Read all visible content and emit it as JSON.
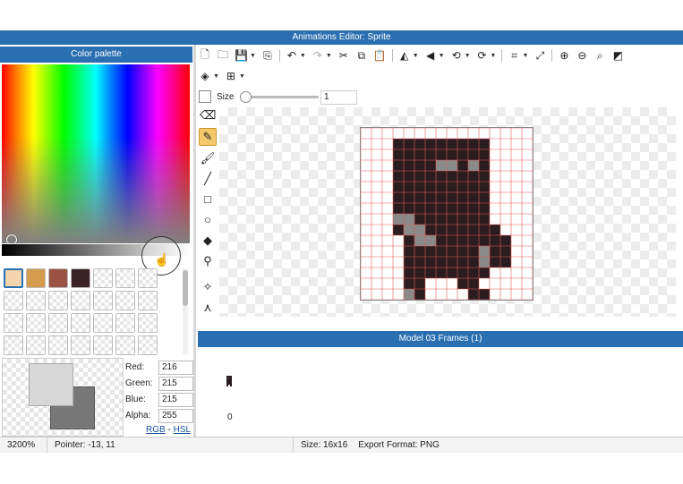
{
  "window": {
    "title": "Animations Editor: Sprite"
  },
  "palette": {
    "title": "Color palette",
    "swatches": [
      {
        "color": "#f5d5ae",
        "filled": true,
        "selected": true
      },
      {
        "color": "#d59b4e",
        "filled": true
      },
      {
        "color": "#9b5143",
        "filled": true
      },
      {
        "color": "#3a2226",
        "filled": true
      },
      {
        "filled": false
      },
      {
        "filled": false
      },
      {
        "filled": false
      },
      {
        "filled": false
      },
      {
        "filled": false
      },
      {
        "filled": false
      },
      {
        "filled": false
      },
      {
        "filled": false
      },
      {
        "filled": false
      },
      {
        "filled": false
      },
      {
        "filled": false
      },
      {
        "filled": false
      },
      {
        "filled": false
      },
      {
        "filled": false
      },
      {
        "filled": false
      },
      {
        "filled": false
      },
      {
        "filled": false
      },
      {
        "filled": false
      },
      {
        "filled": false
      },
      {
        "filled": false
      },
      {
        "filled": false
      },
      {
        "filled": false
      },
      {
        "filled": false
      },
      {
        "filled": false
      }
    ],
    "red_label": "Red:",
    "red": "216",
    "green_label": "Green:",
    "green": "215",
    "blue_label": "Blue:",
    "blue": "215",
    "alpha_label": "Alpha:",
    "alpha": "255",
    "rgb_link": "RGB",
    "link_sep": "-",
    "hsl_link": "HSL",
    "fg_color": "#d8d7d7",
    "bg_color": "#787878"
  },
  "toolbar": {
    "icons": [
      "new-file-icon",
      "open-folder-icon",
      "save-icon",
      "export-icon",
      "undo-icon",
      "redo-icon",
      "cut-icon",
      "copy-icon",
      "paste-icon",
      "flip-horizontal-icon",
      "flip-vertical-icon",
      "rotate-left-icon",
      "rotate-right-icon",
      "crop-icon",
      "resize-icon",
      "zoom-in-icon",
      "zoom-out-icon",
      "zoom-fit-icon",
      "contrast-icon"
    ],
    "icons2": [
      "layers-icon",
      "grid-icon"
    ]
  },
  "brush": {
    "size_label": "Size",
    "size_value": "1"
  },
  "tools": [
    "eraser-icon",
    "pencil-icon",
    "brush-icon",
    "line-icon",
    "rectangle-icon",
    "ellipse-icon",
    "fill-bucket-icon",
    "eyedropper-icon",
    "select-icon",
    "transform-icon"
  ],
  "frames": {
    "title": "Model 03 Frames (1)",
    "frame_number": "0"
  },
  "status": {
    "zoom": "3200%",
    "pointer": "Pointer: -13, 11",
    "size": "Size: 16x16",
    "export_format": "Export Format: PNG"
  },
  "sprite": {
    "grid_size": 16,
    "palette": {
      "0": "",
      "d": "#2b1c1f",
      "g": "#8a8a8a",
      "k": "#3a2a2c"
    },
    "rows": [
      "0000000000000000",
      "000ddddddddd0000",
      "000ddddddddd0000",
      "000ddddggdgd0000",
      "000ddddddddd0000",
      "000ddddddddd0000",
      "000ddddddddd0000",
      "000ddddddddd0000",
      "000ggddddddd0000",
      "000dggddddddd000",
      "0000dggddddddd00",
      "0000dddddddgdd00",
      "0000dddddddgdd00",
      "0000dddddddd0000",
      "0000dd000dd00000",
      "0000gd0000dd0000"
    ]
  }
}
